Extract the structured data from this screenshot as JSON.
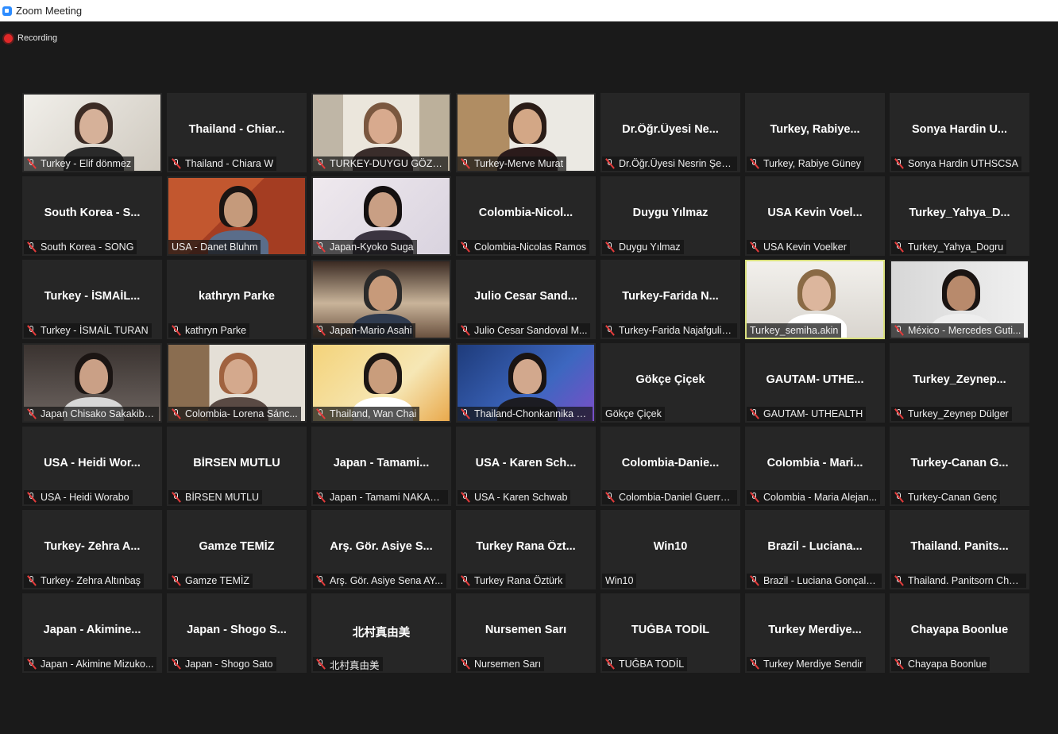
{
  "window": {
    "title": "Zoom Meeting"
  },
  "recording": {
    "label": "Recording"
  },
  "colors": {
    "active_speaker_border": "#d9e07d",
    "background": "#1a1a1a",
    "tile": "#262626",
    "mic_muted": "#e23b3b"
  },
  "icons": {
    "app": "zoom-camera-icon",
    "recording": "record-dot-icon",
    "muted": "mic-muted-icon"
  },
  "participants": [
    {
      "name": "Turkey - Elif dönmez",
      "video": true,
      "muted": true,
      "display": ""
    },
    {
      "name": "Thailand - Chiara W",
      "video": false,
      "muted": true,
      "display": "Thailand - Chiar..."
    },
    {
      "name": "TURKEY-DUYGU GÖZEN",
      "video": true,
      "muted": true,
      "display": ""
    },
    {
      "name": "Turkey-Merve Murat",
      "video": true,
      "muted": true,
      "display": ""
    },
    {
      "name": "Dr.Öğr.Üyesi Nesrin Şen...",
      "video": false,
      "muted": true,
      "display": "Dr.Öğr.Üyesi Ne..."
    },
    {
      "name": "Turkey, Rabiye Güney",
      "video": false,
      "muted": true,
      "display": "Turkey, Rabiye..."
    },
    {
      "name": "Sonya Hardin UTHSCSA",
      "video": false,
      "muted": true,
      "display": "Sonya Hardin U..."
    },
    {
      "name": "South Korea - SONG",
      "video": false,
      "muted": true,
      "display": "South Korea - S..."
    },
    {
      "name": "USA - Danet Bluhm",
      "video": true,
      "muted": false,
      "display": ""
    },
    {
      "name": "Japan-Kyoko Suga",
      "video": true,
      "muted": true,
      "display": ""
    },
    {
      "name": "Colombia-Nicolas Ramos",
      "video": false,
      "muted": true,
      "display": "Colombia-Nicol..."
    },
    {
      "name": "Duygu Yılmaz",
      "video": false,
      "muted": true,
      "display": "Duygu Yılmaz"
    },
    {
      "name": "USA Kevin Voelker",
      "video": false,
      "muted": true,
      "display": "USA Kevin Voel..."
    },
    {
      "name": "Turkey_Yahya_Dogru",
      "video": false,
      "muted": true,
      "display": "Turkey_Yahya_D..."
    },
    {
      "name": "Turkey - İSMAİL TURAN",
      "video": false,
      "muted": true,
      "display": "Turkey - İSMAİL..."
    },
    {
      "name": "kathryn Parke",
      "video": false,
      "muted": true,
      "display": "kathryn Parke"
    },
    {
      "name": "Japan-Mario Asahi",
      "video": true,
      "muted": true,
      "display": ""
    },
    {
      "name": "Julio Cesar Sandoval M...",
      "video": false,
      "muted": true,
      "display": "Julio Cesar Sand..."
    },
    {
      "name": "Turkey-Farida Najafguliy...",
      "video": false,
      "muted": true,
      "display": "Turkey-Farida N..."
    },
    {
      "name": "Turkey_semiha.akin",
      "video": true,
      "muted": false,
      "active": true,
      "display": ""
    },
    {
      "name": "México - Mercedes Guti...",
      "video": true,
      "muted": true,
      "display": ""
    },
    {
      "name": "Japan  Chisako Sakakiba...",
      "video": true,
      "muted": true,
      "display": ""
    },
    {
      "name": "Colombia- Lorena Sánc...",
      "video": true,
      "muted": true,
      "display": ""
    },
    {
      "name": "Thailand, Wan Chai",
      "video": true,
      "muted": true,
      "display": ""
    },
    {
      "name": "Thailand-Chonkannika N...",
      "video": true,
      "muted": true,
      "display": ""
    },
    {
      "name": "Gökçe Çiçek",
      "video": false,
      "muted": false,
      "display": "Gökçe Çiçek"
    },
    {
      "name": "GAUTAM- UTHEALTH",
      "video": false,
      "muted": true,
      "display": "GAUTAM- UTHE..."
    },
    {
      "name": "Turkey_Zeynep Dülger",
      "video": false,
      "muted": true,
      "display": "Turkey_Zeynep..."
    },
    {
      "name": "USA - Heidi Worabo",
      "video": false,
      "muted": true,
      "display": "USA - Heidi Wor..."
    },
    {
      "name": "BİRSEN MUTLU",
      "video": false,
      "muted": true,
      "display": "BİRSEN MUTLU"
    },
    {
      "name": "Japan - Tamami NAKAU...",
      "video": false,
      "muted": true,
      "display": "Japan - Tamami..."
    },
    {
      "name": "USA - Karen Schwab",
      "video": false,
      "muted": true,
      "display": "USA - Karen Sch..."
    },
    {
      "name": "Colombia-Daniel Guerre...",
      "video": false,
      "muted": true,
      "display": "Colombia-Danie..."
    },
    {
      "name": "Colombia - Maria Alejan...",
      "video": false,
      "muted": true,
      "display": "Colombia - Mari..."
    },
    {
      "name": "Turkey-Canan Genç",
      "video": false,
      "muted": true,
      "display": "Turkey-Canan G..."
    },
    {
      "name": "Turkey- Zehra Altınbaş",
      "video": false,
      "muted": true,
      "display": "Turkey- Zehra A..."
    },
    {
      "name": "Gamze TEMİZ",
      "video": false,
      "muted": true,
      "display": "Gamze TEMİZ"
    },
    {
      "name": "Arş. Gör. Asiye Sena AY...",
      "video": false,
      "muted": true,
      "display": "Arş. Gör. Asiye S..."
    },
    {
      "name": "Turkey Rana Öztürk",
      "video": false,
      "muted": true,
      "display": "Turkey Rana Özt..."
    },
    {
      "name": "Win10",
      "video": false,
      "muted": false,
      "display": "Win10"
    },
    {
      "name": "Brazil - Luciana Gonçalves",
      "video": false,
      "muted": true,
      "display": "Brazil - Luciana..."
    },
    {
      "name": "Thailand. Panitsorn Char...",
      "video": false,
      "muted": true,
      "display": "Thailand. Panits..."
    },
    {
      "name": "Japan - Akimine Mizuko...",
      "video": false,
      "muted": true,
      "display": "Japan - Akimine..."
    },
    {
      "name": "Japan - Shogo Sato",
      "video": false,
      "muted": true,
      "display": "Japan - Shogo S..."
    },
    {
      "name": "北村真由美",
      "video": false,
      "muted": true,
      "display": "北村真由美"
    },
    {
      "name": "Nursemen Sarı",
      "video": false,
      "muted": true,
      "display": "Nursemen Sarı"
    },
    {
      "name": "TUĞBA TODİL",
      "video": false,
      "muted": true,
      "display": "TUĞBA TODİL"
    },
    {
      "name": "Turkey Merdiye Sendir",
      "video": false,
      "muted": true,
      "display": "Turkey  Merdiye..."
    },
    {
      "name": "Chayapa Boonlue",
      "video": false,
      "muted": true,
      "display": "Chayapa Boonlue"
    }
  ]
}
